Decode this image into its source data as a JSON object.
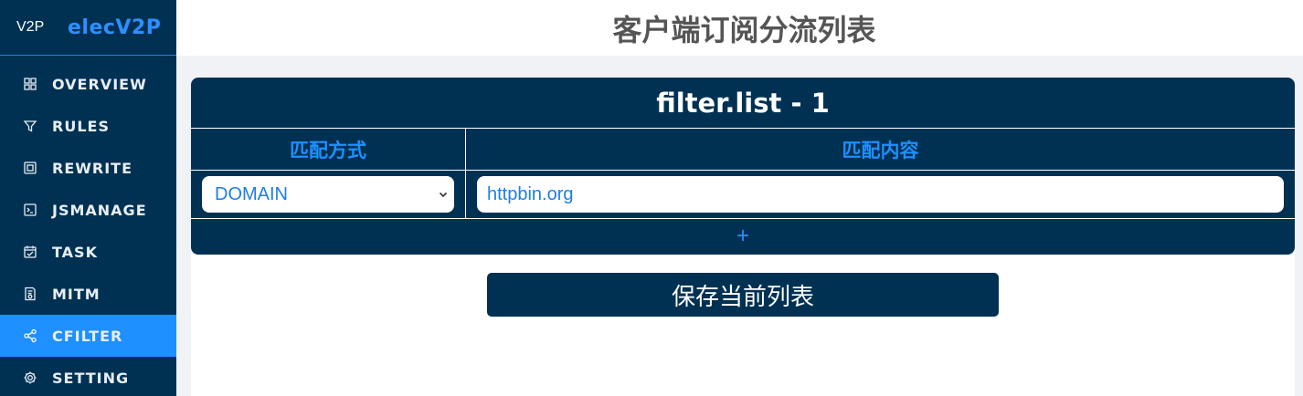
{
  "sidebar": {
    "logo": "V2P",
    "app_name": "elecV2P",
    "items": [
      {
        "label": "OVERVIEW",
        "icon": "grid-icon"
      },
      {
        "label": "RULES",
        "icon": "funnel-icon"
      },
      {
        "label": "REWRITE",
        "icon": "square-icon"
      },
      {
        "label": "JSMANAGE",
        "icon": "terminal-icon"
      },
      {
        "label": "TASK",
        "icon": "calendar-icon"
      },
      {
        "label": "MITM",
        "icon": "certificate-icon"
      },
      {
        "label": "CFILTER",
        "icon": "share-icon",
        "active": true
      },
      {
        "label": "SETTING",
        "icon": "gear-icon"
      }
    ]
  },
  "header": {
    "title": "客户端订阅分流列表"
  },
  "card": {
    "title": "filter.list - 1",
    "columns": [
      "匹配方式",
      "匹配内容"
    ],
    "rows": [
      {
        "match_type": "DOMAIN",
        "match_content": "httpbin.org"
      }
    ],
    "add_label": "+"
  },
  "save_button": {
    "label": "保存当前列表"
  },
  "colors": {
    "navy": "#003153",
    "accent": "#1e90ff",
    "background": "#f0f2f5"
  }
}
